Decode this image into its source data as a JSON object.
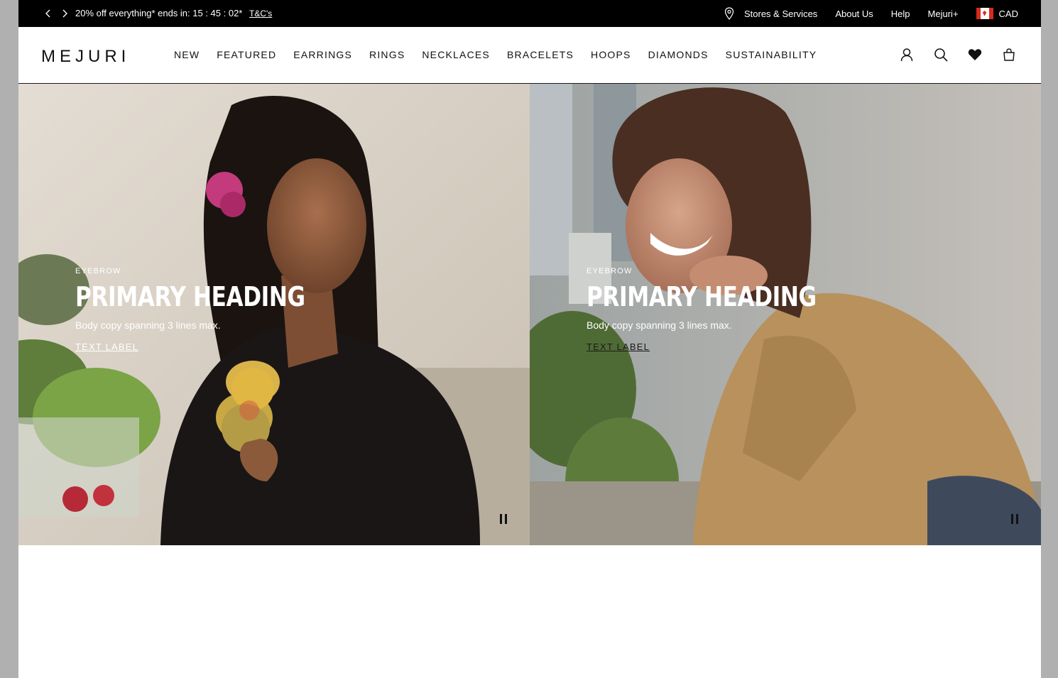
{
  "announcement": {
    "promo_text": "20% off everything* ends in: 15 : 45 : 02*",
    "terms_link": "T&C's"
  },
  "utility_links": {
    "stores": "Stores & Services",
    "about": "About Us",
    "help": "Help",
    "membership": "Mejuri+",
    "currency": "CAD"
  },
  "header": {
    "logo": "MEJURI",
    "nav": [
      "NEW",
      "FEATURED",
      "EARRINGS",
      "RINGS",
      "NECKLACES",
      "BRACELETS",
      "HOOPS",
      "DIAMONDS",
      "SUSTAINABILITY"
    ]
  },
  "icons": {
    "account": "user-icon",
    "search": "search-icon",
    "wishlist": "heart-icon",
    "bag": "shopping-bag-icon",
    "location": "map-pin-icon",
    "prev": "chevron-left-icon",
    "next": "chevron-right-icon",
    "pause": "pause-icon",
    "flag": "canada-flag-icon"
  },
  "hero": {
    "panels": [
      {
        "eyebrow": "EYEBROW",
        "heading": "PRIMARY HEADING",
        "body": "Body copy spanning 3 lines max.",
        "cta": "TEXT LABEL"
      },
      {
        "eyebrow": "EYEBROW",
        "heading": "PRIMARY HEADING",
        "body": "Body copy spanning 3 lines max.",
        "cta": "TEXT LABEL"
      }
    ]
  }
}
